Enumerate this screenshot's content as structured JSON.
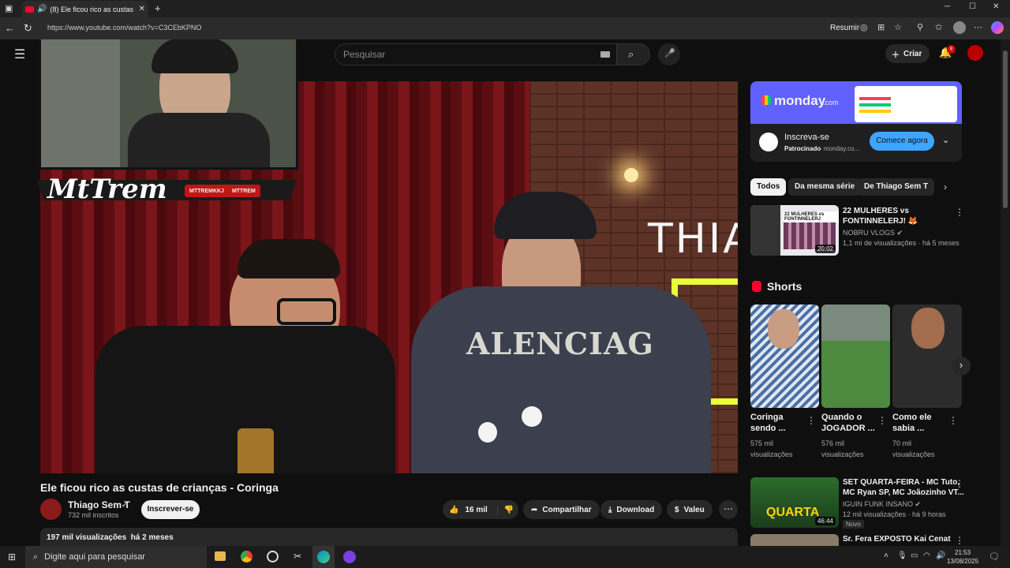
{
  "browser": {
    "tab_title": "(8) Ele ficou rico as custas de",
    "address_partial": "https://www.youtube.com/watch?v=C3CEbKPNO",
    "resumir_label": "Resumir"
  },
  "youtube": {
    "search_placeholder": "Pesquisar",
    "create_label": "Criar",
    "notif_count": "8"
  },
  "overlay": {
    "brand": "MtTrem",
    "social_1": "MTTREMKKJ",
    "social_2": "MTTREM"
  },
  "scene": {
    "wall_text": "THIAG",
    "hoodie_text": "ALENCIAG"
  },
  "video": {
    "title": "Ele ficou rico as custas de crianças - Coringa",
    "channel": "Thiago Sem T",
    "subscribers": "732 mil inscritos",
    "subscribe_label": "Inscrever-se",
    "likes": "16 mil",
    "share_label": "Compartilhar",
    "download_label": "Download",
    "thanks_label": "Valeu",
    "views": "197 mil visualizações",
    "age": "há 2 meses"
  },
  "ad": {
    "brand": "monday",
    "brand_suffix": ".com",
    "title": "Inscreva-se",
    "sponsored": "Patrocinado",
    "domain": "· monday.co...",
    "cta": "Comece agora"
  },
  "chips": [
    "Todos",
    "Da mesma série",
    "De Thiago Sem T"
  ],
  "rec1": {
    "thumb_text": "22 MULHERES vs FONTINNELERJ",
    "title_line1": "22 MULHERES vs",
    "title_line2": "FONTINNELERJ! 🦊",
    "channel": "NOBRU VLOGS",
    "stats": "1,1 mi de visualizações · há 5 meses",
    "duration": "20:02"
  },
  "shorts": {
    "heading": "Shorts",
    "items": [
      {
        "title_1": "Coringa",
        "title_2": "sendo ...",
        "views_1": "575 mil",
        "views_2": "visualizações"
      },
      {
        "title_1": "Quando o",
        "title_2": "JOGADOR ...",
        "views_1": "576 mil",
        "views_2": "visualizações"
      },
      {
        "title_1": "Como ele",
        "title_2": "sabia ...",
        "views_1": "70 mil",
        "views_2": "visualizações"
      }
    ]
  },
  "rec2": {
    "title_line1": "SET QUARTA-FEIRA - MC Tuto,",
    "title_line2": "MC Ryan SP, MC Joãozinho VT...",
    "channel": "IGUIN FUNK INSANO",
    "stats": "12 mil visualizações · há 9 horas",
    "badge": "Novo",
    "duration": "46:44",
    "thumb_text": "QUARTA"
  },
  "rec3": {
    "title": "Sr. Fera EXPOSTO Kai Cenat"
  },
  "taskbar": {
    "search_placeholder": "Digite aqui para pesquisar",
    "time": "21:53",
    "date": "13/08/2025"
  },
  "colors": {
    "yt_red": "#ff0033",
    "accent_blue": "#3ea6ff",
    "monday_purple": "#6161ff"
  }
}
